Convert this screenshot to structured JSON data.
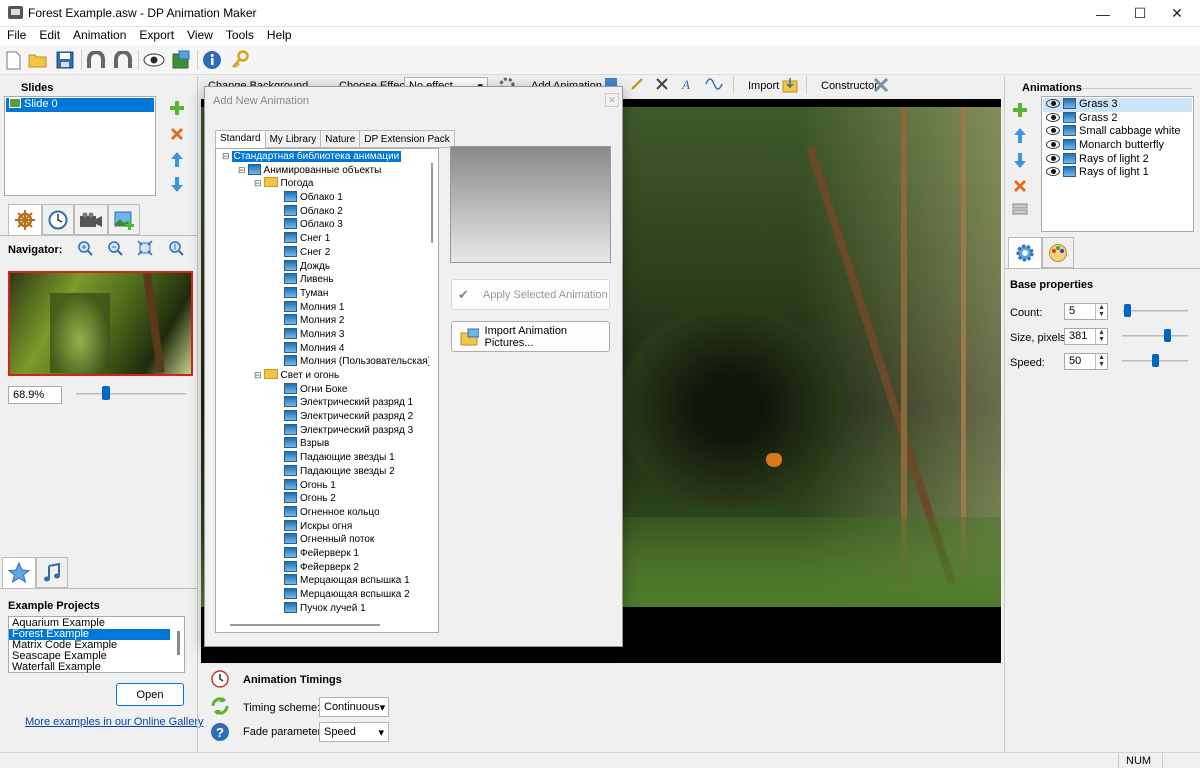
{
  "window": {
    "title": "Forest Example.asw - DP Animation Maker",
    "minimize": "—",
    "maximize": "☐",
    "close": "✕"
  },
  "menu": [
    "File",
    "Edit",
    "Animation",
    "Export",
    "View",
    "Tools",
    "Help"
  ],
  "second_toolbar": {
    "change_background": "Change Background",
    "choose_effect_label": "Choose Effect:",
    "choose_effect_value": "No effect",
    "add_animation": "Add Animation",
    "import": "Import",
    "constructor": "Constructor"
  },
  "slides": {
    "title": "Slides",
    "items": [
      "Slide 0"
    ]
  },
  "navigator": {
    "label": "Navigator:",
    "zoom": "68.9%",
    "zoom_level": 0.25
  },
  "example_projects": {
    "title": "Example Projects",
    "items": [
      "Aquarium Example",
      "Forest Example",
      "Matrix Code Example",
      "Seascape Example",
      "Waterfall Example"
    ],
    "selected_index": 1,
    "open_button": "Open",
    "gallery_link": "More examples in our Online Gallery"
  },
  "dialog": {
    "title": "Add New Animation",
    "tabs": [
      "Standard",
      "My Library",
      "Nature",
      "DP Extension Pack"
    ],
    "apply_button": "Apply Selected Animation",
    "import_button": "Import Animation Pictures...",
    "tree": {
      "root": "Стандартная библиотека анимации",
      "group": "Анимированные объекты",
      "folders": [
        {
          "name": "Погода",
          "items": [
            "Облако 1",
            "Облако 2",
            "Облако 3",
            "Снег 1",
            "Снег 2",
            "Дождь",
            "Ливень",
            "Туман",
            "Молния 1",
            "Молния 2",
            "Молния 3",
            "Молния 4",
            "Молния (Пользовательская)"
          ]
        },
        {
          "name": "Свет и огонь",
          "items": [
            "Огни Боке",
            "Электрический разряд 1",
            "Электрический разряд 2",
            "Электрический разряд 3",
            "Взрыв",
            "Падающие звезды 1",
            "Падающие звезды 2",
            "Огонь 1",
            "Огонь 2",
            "Огненное кольцо",
            "Искры огня",
            "Огненный поток",
            "Фейерверк 1",
            "Фейерверк 2",
            "Мерцающая вспышка 1",
            "Мерцающая вспышка 2",
            "Пучок лучей 1"
          ]
        }
      ]
    }
  },
  "timings": {
    "title": "Animation Timings",
    "scheme_label": "Timing scheme:",
    "scheme_value": "Continuous",
    "fade_label": "Fade parameter:",
    "fade_value": "Speed"
  },
  "animations": {
    "title": "Animations",
    "items": [
      "Grass 3",
      "Grass 2",
      "Small cabbage white",
      "Monarch butterfly",
      "Rays of light 2",
      "Rays of light 1"
    ],
    "selected_index": 0
  },
  "base_properties": {
    "title": "Base properties",
    "fields": [
      {
        "label": "Count:",
        "value": "5",
        "level": 0.03
      },
      {
        "label": "Size, pixels:",
        "value": "381",
        "level": 0.72
      },
      {
        "label": "Speed:",
        "value": "50",
        "level": 0.5
      }
    ]
  },
  "status": {
    "num": "NUM"
  }
}
